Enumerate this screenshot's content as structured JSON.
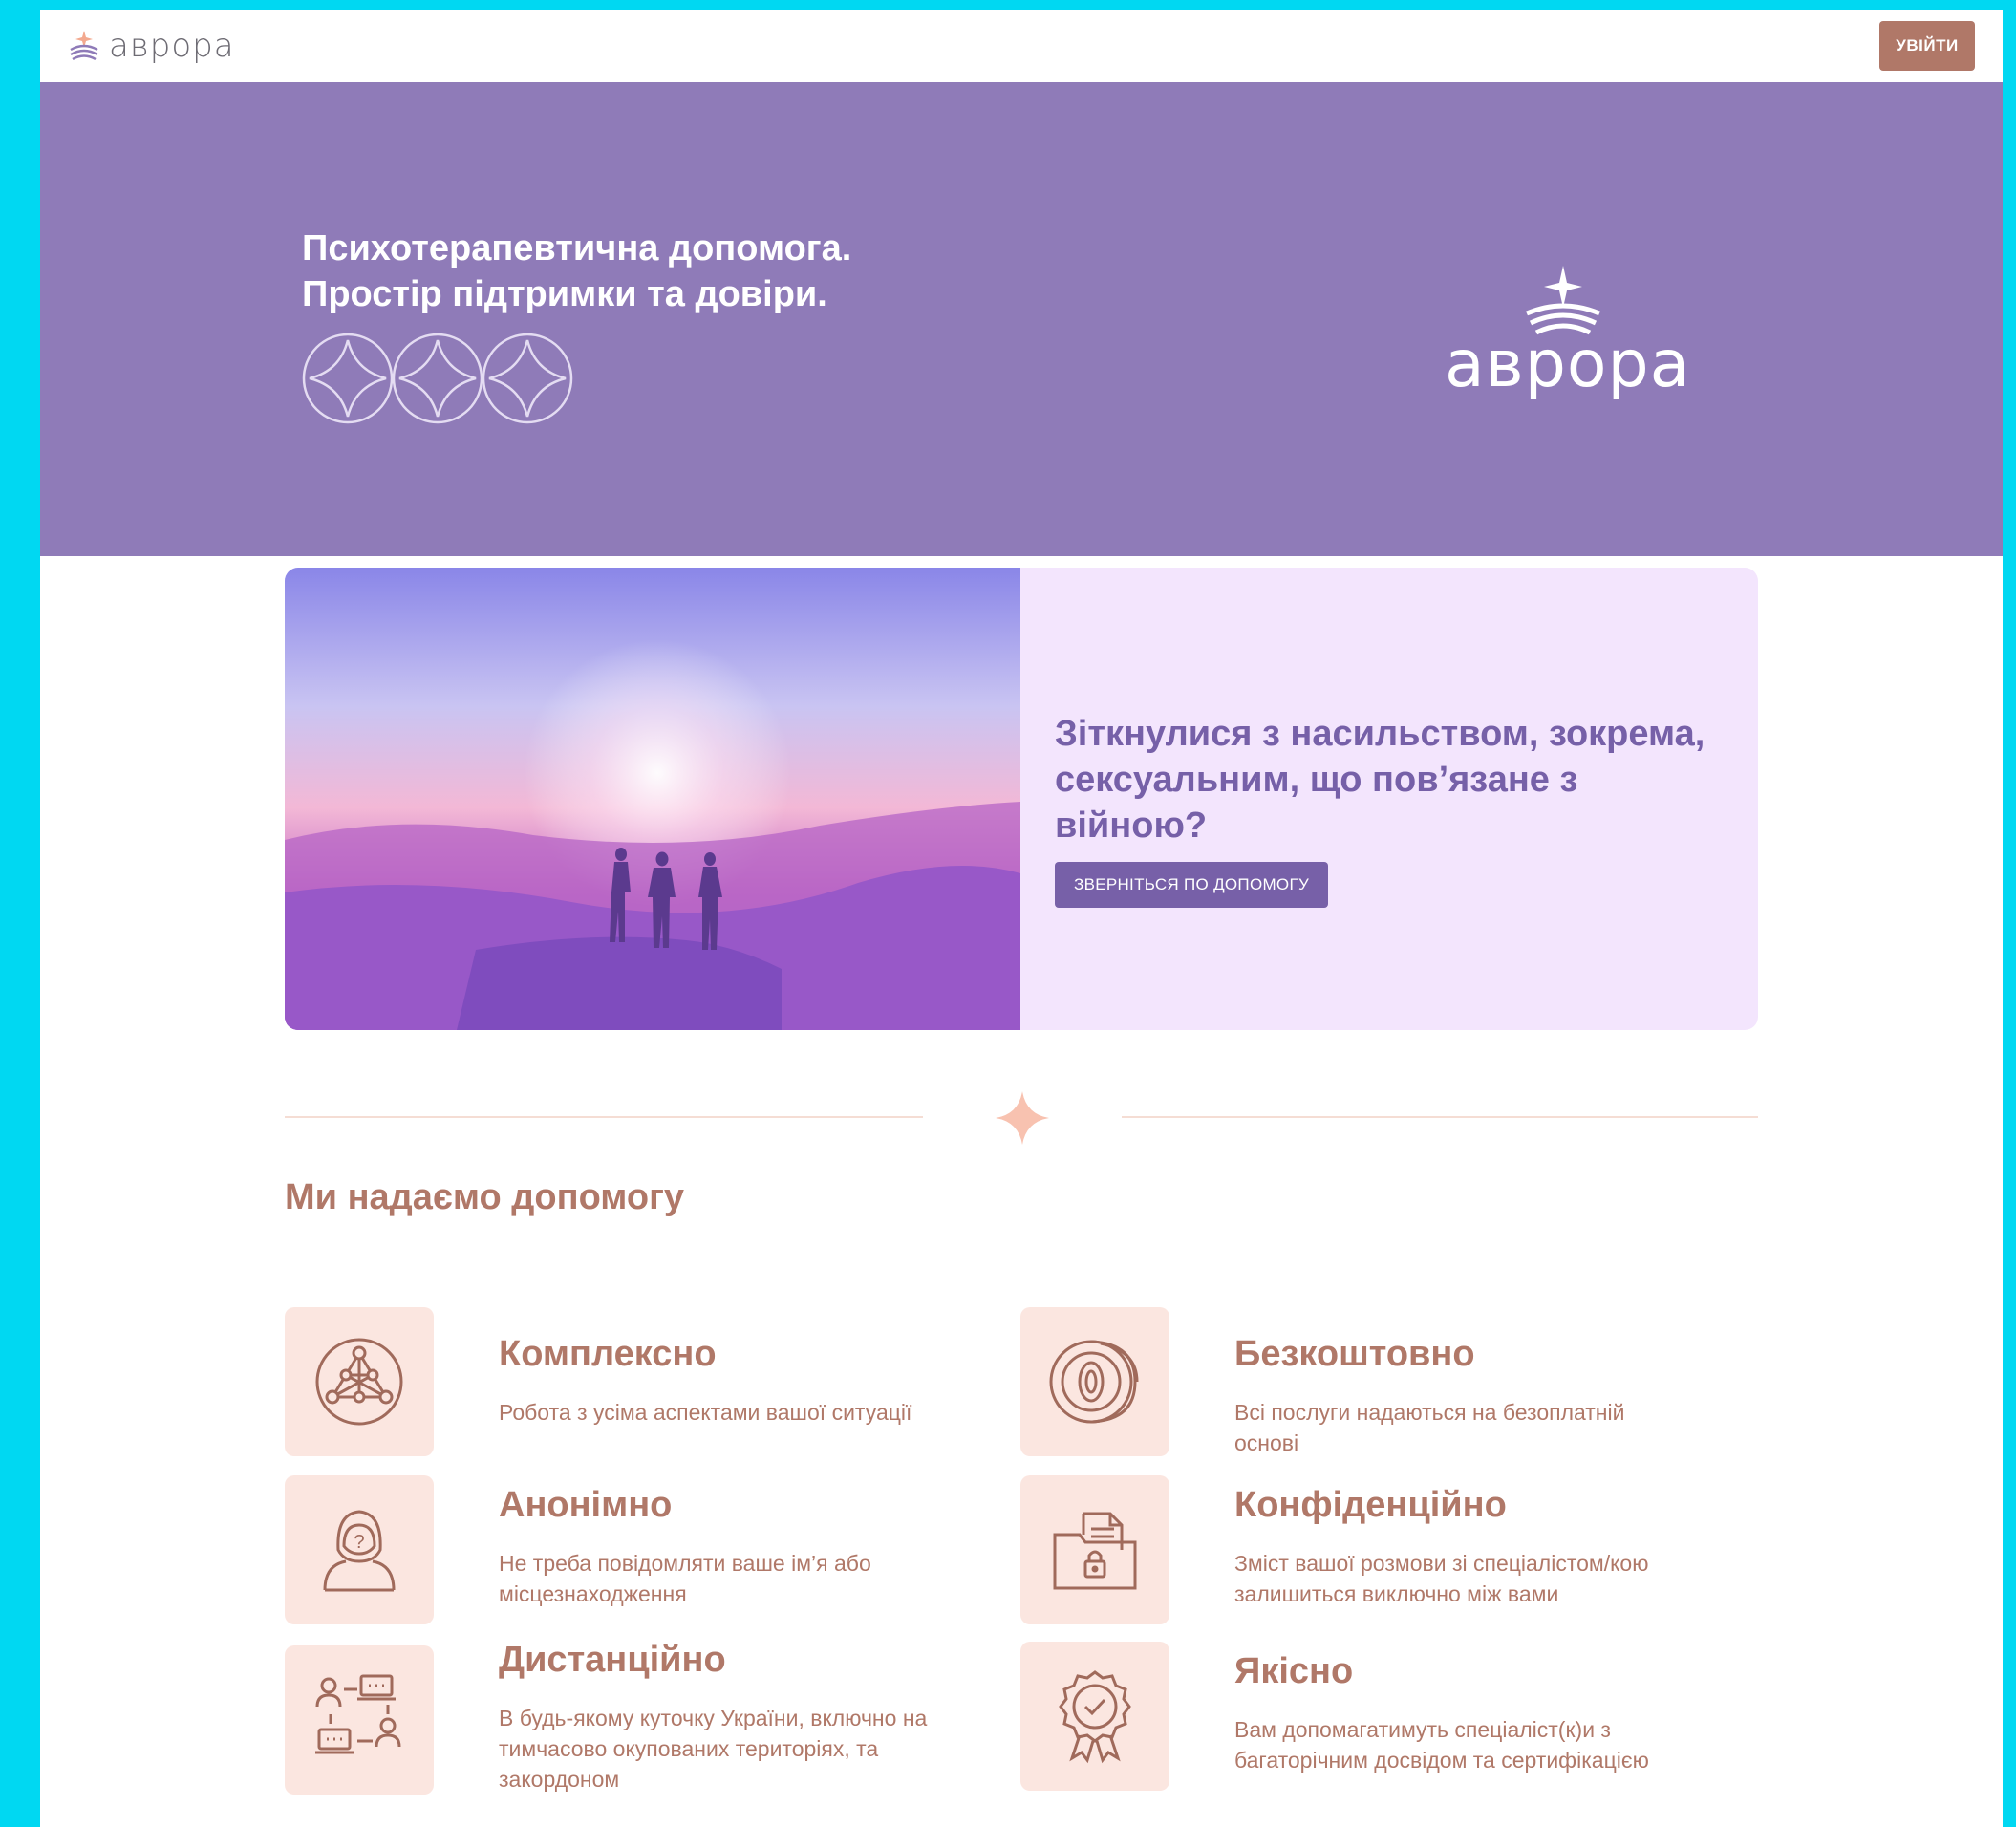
{
  "app": {
    "brand_name": "аврора"
  },
  "header": {
    "login_label": "УВІЙТИ"
  },
  "hero": {
    "title_line1": "Психотерапевтична допомога.",
    "title_line2": "Простір підтримки та довіри.",
    "logo_text": "аврора"
  },
  "banner": {
    "heading": "Зіткнулися з насильством, зокрема, сексуальним, що пов’язане з війною?",
    "button_label": "ЗВЕРНІТЬСЯ ПО ДОПОМОГУ"
  },
  "section": {
    "title": "Ми надаємо допомогу"
  },
  "features": [
    {
      "icon": "network-icon",
      "title": "Комплексно",
      "desc": "Робота з усіма аспектами вашої ситуації"
    },
    {
      "icon": "coin-zero-icon",
      "title": "Безкоштовно",
      "desc": "Всі послуги надаються на безоплатній основі"
    },
    {
      "icon": "anonymous-person-icon",
      "title": "Анонімно",
      "desc": "Не треба повідомляти ваше ім’я або місцезнаходження"
    },
    {
      "icon": "locked-folder-icon",
      "title": "Конфіденційно",
      "desc": "Зміст вашої розмови зі спеціалістом/кою залишиться виключно між вами"
    },
    {
      "icon": "remote-chat-icon",
      "title": "Дистанційно",
      "desc": "В будь-якому куточку України, включно на тимчасово окупованих територіях, та закордоном"
    },
    {
      "icon": "certificate-badge-icon",
      "title": "Якісно",
      "desc": "Вам допомагатимуть спеціаліст(к)и з багаторічним досвідом та сертифікацією"
    }
  ],
  "colors": {
    "hero_bg": "#8f7bb8",
    "accent_brown": "#b07868",
    "accent_purple": "#7760a8",
    "banner_bg": "#f3e5fd",
    "icon_bg": "#fbe6e0",
    "page_frame": "#00d8f2"
  }
}
